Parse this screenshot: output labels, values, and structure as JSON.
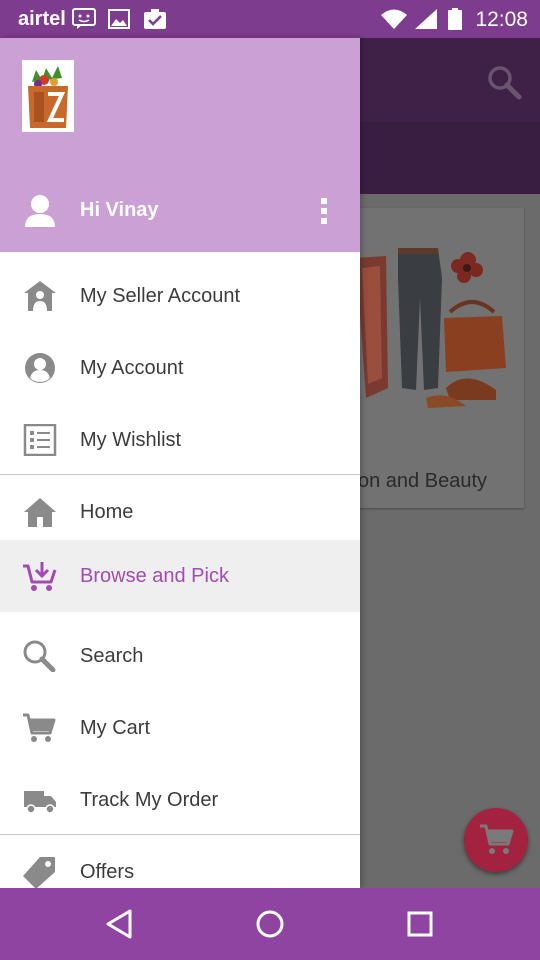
{
  "status_bar": {
    "carrier": "airtel",
    "time": "12:08",
    "icons": [
      "chat-notification-icon",
      "image-notification-icon",
      "clipboard-notification-icon",
      "wifi-icon",
      "signal-icon",
      "battery-icon"
    ]
  },
  "background": {
    "card_label": "on and Beauty",
    "icons": [
      "search-icon",
      "cart-icon"
    ]
  },
  "drawer": {
    "greeting": "Hi Vinay",
    "logo": "app-logo",
    "groups": [
      {
        "items": [
          {
            "label": "My Seller Account",
            "icon": "seller-account-icon"
          },
          {
            "label": "My Account",
            "icon": "account-icon"
          },
          {
            "label": "My Wishlist",
            "icon": "wishlist-icon"
          }
        ]
      },
      {
        "items": [
          {
            "label": "Home",
            "icon": "home-icon"
          },
          {
            "label": "Browse and Pick",
            "icon": "browse-cart-icon",
            "active": true
          },
          {
            "label": "Search",
            "icon": "search-icon"
          },
          {
            "label": "My Cart",
            "icon": "cart-icon"
          },
          {
            "label": "Track My Order",
            "icon": "truck-icon"
          }
        ]
      },
      {
        "items": [
          {
            "label": "Offers",
            "icon": "tag-icon"
          }
        ]
      }
    ]
  },
  "nav_bar": {
    "buttons": [
      "back-icon",
      "home-circle-icon",
      "recents-icon"
    ]
  },
  "colors": {
    "status_bar": "#7d3c8d",
    "drawer_header": "#cba0d4",
    "accent": "#a24bb2",
    "nav_bar": "#8e44a0",
    "fab": "#a3223f"
  }
}
